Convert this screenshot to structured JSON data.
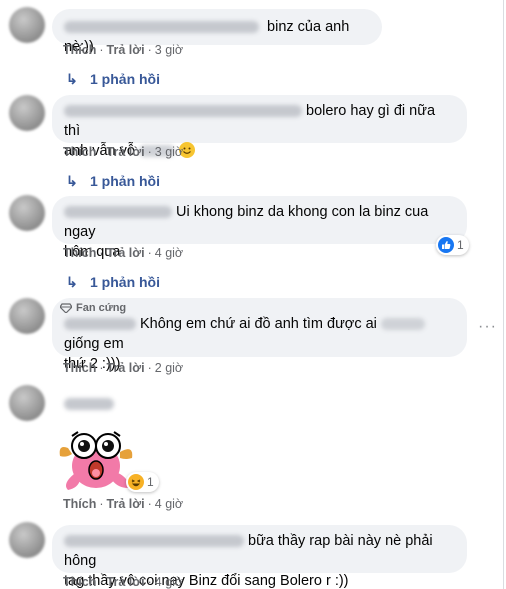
{
  "colors": {
    "bubble": "#f0f2f5",
    "link": "#385898",
    "meta": "#65676b",
    "like": "#1877f2"
  },
  "comments": [
    {
      "text": "binz của anh nè:))",
      "actions": {
        "like": "Thích",
        "reply": "Trả lời",
        "time": "3 giờ"
      },
      "replies": "1 phản hồi"
    },
    {
      "text_a": "bolero hay gì đi nữa thì",
      "text_b": "anh vẫn vỗ",
      "emoji": "smile-emoji-icon",
      "actions": {
        "like": "Thích",
        "reply": "Trả lời",
        "time": "3 giờ"
      },
      "replies": "1 phản hồi"
    },
    {
      "text_a": "Ui khong binz da khong con la binz cua ngay",
      "text_b": "hôm qua",
      "reaction": {
        "icon": "like-icon",
        "count": "1"
      },
      "actions": {
        "like": "Thích",
        "reply": "Trả lời",
        "time": "4 giờ"
      },
      "replies": "1 phản hồi"
    },
    {
      "badge": "Fan cứng",
      "text_a": "Không em chứ ai đồ anh tìm được ai",
      "text_a2": "giống em",
      "text_b": "thứ 2 :)))",
      "actions": {
        "like": "Thích",
        "reply": "Trả lời",
        "time": "2 giờ"
      }
    },
    {
      "sticker": "surprised-pink-sticker",
      "reaction": {
        "icon": "haha-icon",
        "count": "1"
      },
      "actions": {
        "like": "Thích",
        "reply": "Trả lời",
        "time": "4 giờ"
      }
    },
    {
      "text_a": "bữa thầy rap bài này nè phải hông",
      "text_b": "tag thầy vô coi nay Binz đổi sang Bolero r :))",
      "actions": {
        "like": "Thích",
        "reply": "Trả lời",
        "time": "4 giờ"
      }
    }
  ]
}
